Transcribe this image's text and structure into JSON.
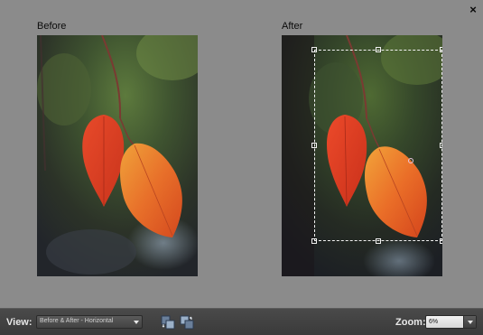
{
  "canvas": {
    "close_label": "×",
    "before_label": "Before",
    "after_label": "After"
  },
  "toolbar": {
    "view_label": "View:",
    "view_value": "Before & After - Horizontal",
    "zoom_label": "Zoom:",
    "zoom_value": "6%"
  },
  "icons": {
    "close": "close-icon",
    "swap": "swap-before-after-icon",
    "copy": "copy-after-to-before-icon",
    "dropdown": "chevron-down-icon"
  },
  "colors": {
    "canvas_bg": "#8b8b8b",
    "toolbar_bg": "#404040",
    "crop_border": "#f2f2f2"
  }
}
